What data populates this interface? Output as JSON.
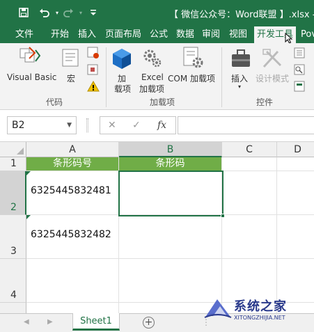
{
  "window": {
    "title": "【 微信公众号：Word联盟 】.xlsx - Ex",
    "save_icon": "save-icon",
    "undo_icon": "undo-icon",
    "redo_icon": "redo-icon",
    "customize_icon": "customize-quick-access-icon"
  },
  "tabs": [
    {
      "label": "文件"
    },
    {
      "label": "开始"
    },
    {
      "label": "插入"
    },
    {
      "label": "页面布局"
    },
    {
      "label": "公式"
    },
    {
      "label": "数据"
    },
    {
      "label": "审阅"
    },
    {
      "label": "视图"
    },
    {
      "label": "开发工具",
      "active": true
    },
    {
      "label": "Pov"
    }
  ],
  "ribbon": {
    "code_group": {
      "label": "代码",
      "visual_basic": "Visual Basic",
      "macros": "宏"
    },
    "addins_group": {
      "label": "加载项",
      "addins": "加\n载项",
      "addins_line1": "加",
      "addins_line2": "载项",
      "excel_addins_line1": "Excel",
      "excel_addins_line2": "加载项",
      "com_addins": "COM 加载项"
    },
    "controls_group": {
      "label": "控件",
      "insert": "插入",
      "design_mode": "设计模式"
    }
  },
  "formula_bar": {
    "name_box": "B2",
    "cancel_symbol": "✕",
    "enter_symbol": "✓",
    "fx_symbol": "fx"
  },
  "grid": {
    "columns": [
      "A",
      "B",
      "C",
      "D"
    ],
    "rows": [
      "1",
      "2",
      "3",
      "4"
    ],
    "cells": {
      "A1": "条形码号",
      "B1": "条形码",
      "A2": "6325445832481",
      "A3": "6325445832482"
    },
    "selected_cell": "B2"
  },
  "sheets": {
    "active": "Sheet1",
    "add_symbol": "+"
  },
  "watermark": {
    "text": "系统之家",
    "sub": "XITONGZHIJIA.NET"
  },
  "colors": {
    "excel_green": "#217346",
    "header_green": "#70ad47"
  }
}
